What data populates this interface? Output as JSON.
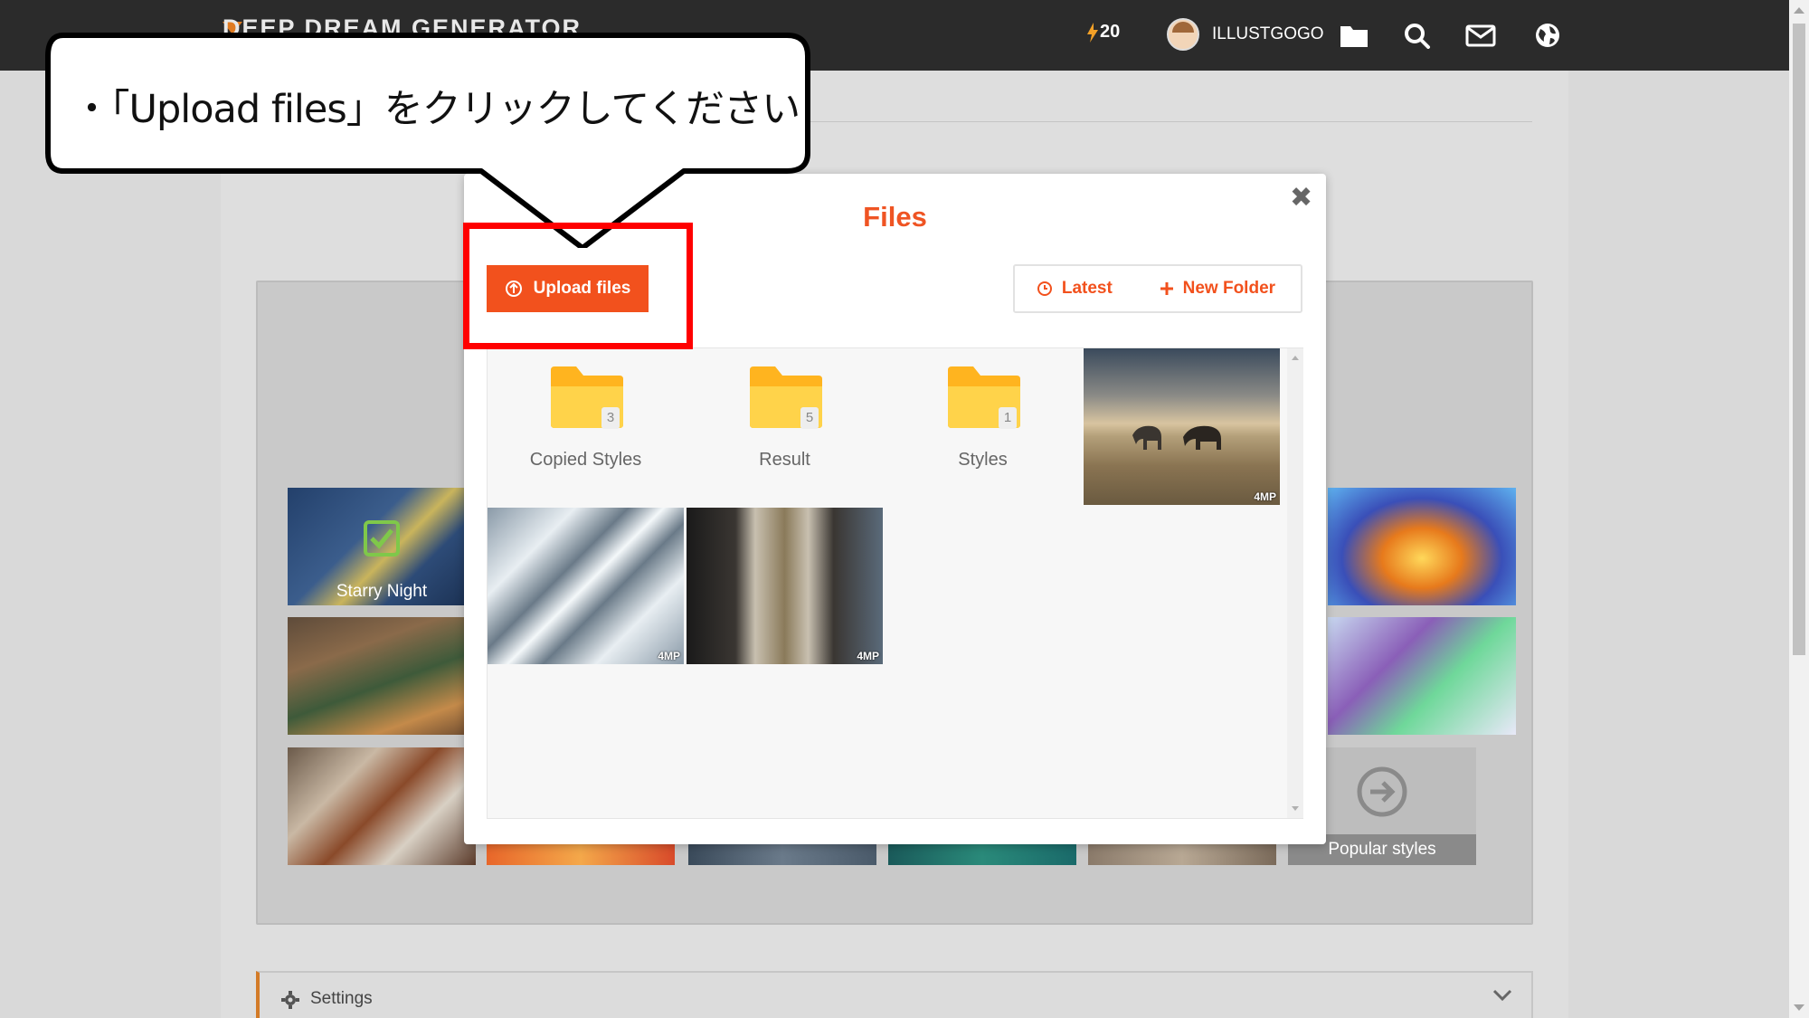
{
  "topbar": {
    "brand": "DEEP DREAM GENERATOR",
    "energy_count": "20",
    "username": "ILLUSTGOGO"
  },
  "background_tiles": {
    "starry_night": "Starry Night",
    "popular_styles": "Popular styles"
  },
  "settings": {
    "label": "Settings"
  },
  "modal": {
    "title": "Files",
    "close_symbol": "✖",
    "upload_label": "Upload files",
    "latest_label": "Latest",
    "new_folder_label": "New Folder",
    "folders": [
      {
        "name": "Copied Styles",
        "count": "3"
      },
      {
        "name": "Result",
        "count": "5"
      },
      {
        "name": "Styles",
        "count": "1"
      }
    ],
    "image_badge": "4MP"
  },
  "callout": {
    "text": "・「Upload files」をクリックしてください"
  },
  "colors": {
    "accent": "#f2511d",
    "topbar": "#2b2b2b",
    "highlight": "#ff0000",
    "folder": "#ffc933"
  },
  "icons": [
    "energy-icon",
    "folder-icon",
    "search-icon",
    "mail-icon",
    "globe-icon",
    "upload-icon",
    "clock-icon",
    "plus-icon",
    "close-icon",
    "gear-icon",
    "chevron-down-icon",
    "arrow-right-circle-icon",
    "checkbox-icon"
  ]
}
